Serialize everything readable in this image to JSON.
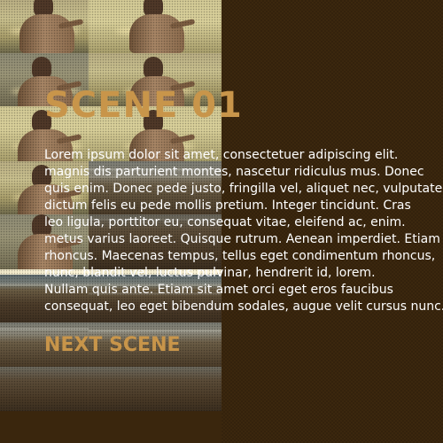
{
  "scene": {
    "title": "SCENE 01",
    "body_lines": [
      "Lorem ipsum dolor sit amet, consectetuer adipiscing elit.",
      "magnis dis parturient montes, nascetur ridiculus mus. Donec",
      "quis enim. Donec pede justo, fringilla vel, aliquet nec, vulputate",
      "dictum felis eu pede mollis pretium. Integer tincidunt. Cras",
      "leo ligula, porttitor eu, consequat vitae, eleifend ac, enim.",
      "metus varius laoreet. Quisque rutrum. Aenean imperdiet. Etiam",
      "rhoncus. Maecenas tempus, tellus eget condimentum rhoncus,",
      "nunc, blandit vel, luctus pulvinar, hendrerit id, lorem.",
      "Nullam quis ante. Etiam sit amet orci eget eros faucibus",
      "consequat, leo eget bibendum sodales, augue velit cursus nunc."
    ],
    "next_label": "NEXT SCENE"
  },
  "colors": {
    "panel_bg": "#3b270e",
    "accent": "#c8954a",
    "text": "#ffffff"
  }
}
